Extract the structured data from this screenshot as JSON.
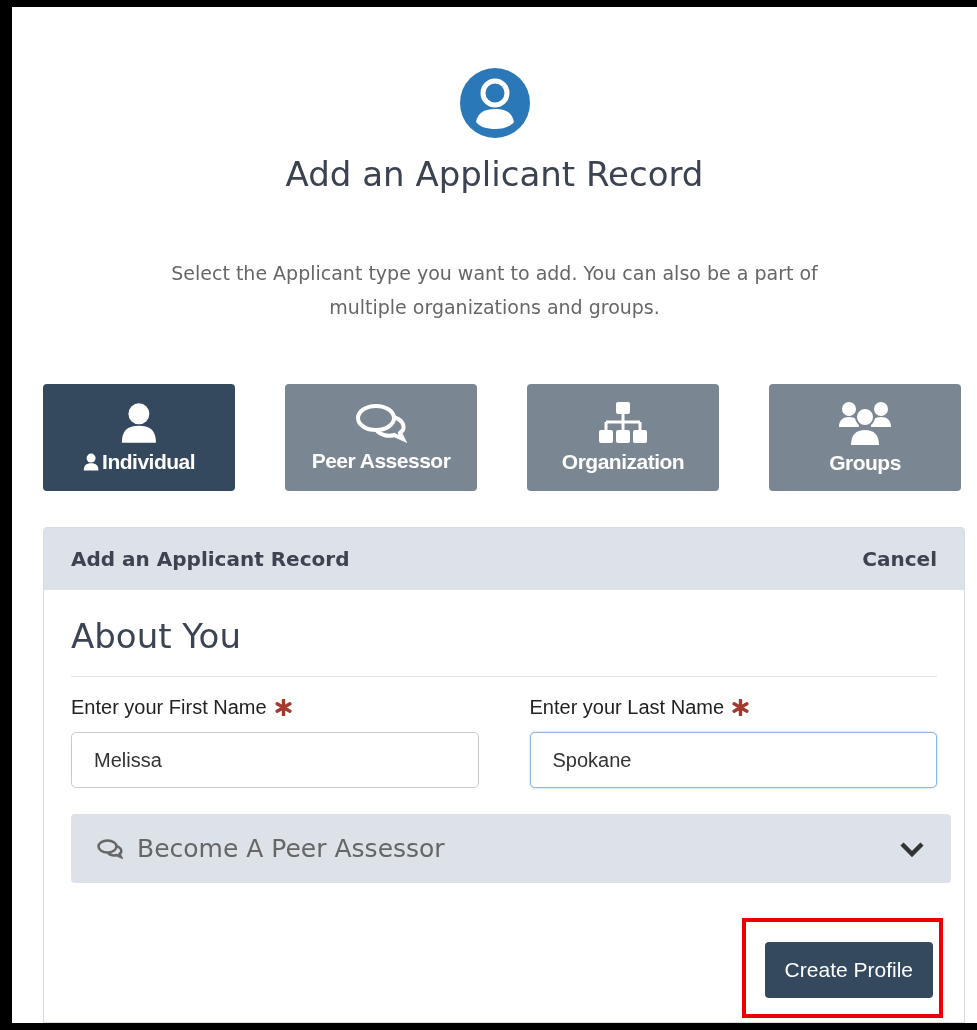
{
  "header": {
    "title": "Add an Applicant Record",
    "description": "Select the Applicant type you want to add. You can also be a part of multiple organizations and groups."
  },
  "tabs": [
    {
      "kind": "individual",
      "label": "Individual",
      "selected": true
    },
    {
      "kind": "peer",
      "label": "Peer Assessor",
      "selected": false
    },
    {
      "kind": "organization",
      "label": "Organization",
      "selected": false
    },
    {
      "kind": "groups",
      "label": "Groups",
      "selected": false
    }
  ],
  "panel": {
    "title": "Add an Applicant Record",
    "cancel": "Cancel",
    "section_title": "About You",
    "fields": [
      {
        "label": "Enter your First Name",
        "required": true,
        "value": "Melissa",
        "focused": false
      },
      {
        "label": "Enter your Last Name",
        "required": true,
        "value": "Spokane",
        "focused": true
      }
    ],
    "accordion": {
      "label": "Become A Peer Assessor",
      "expanded": false
    },
    "submit": {
      "label": "Create Profile",
      "highlighted": true
    }
  }
}
